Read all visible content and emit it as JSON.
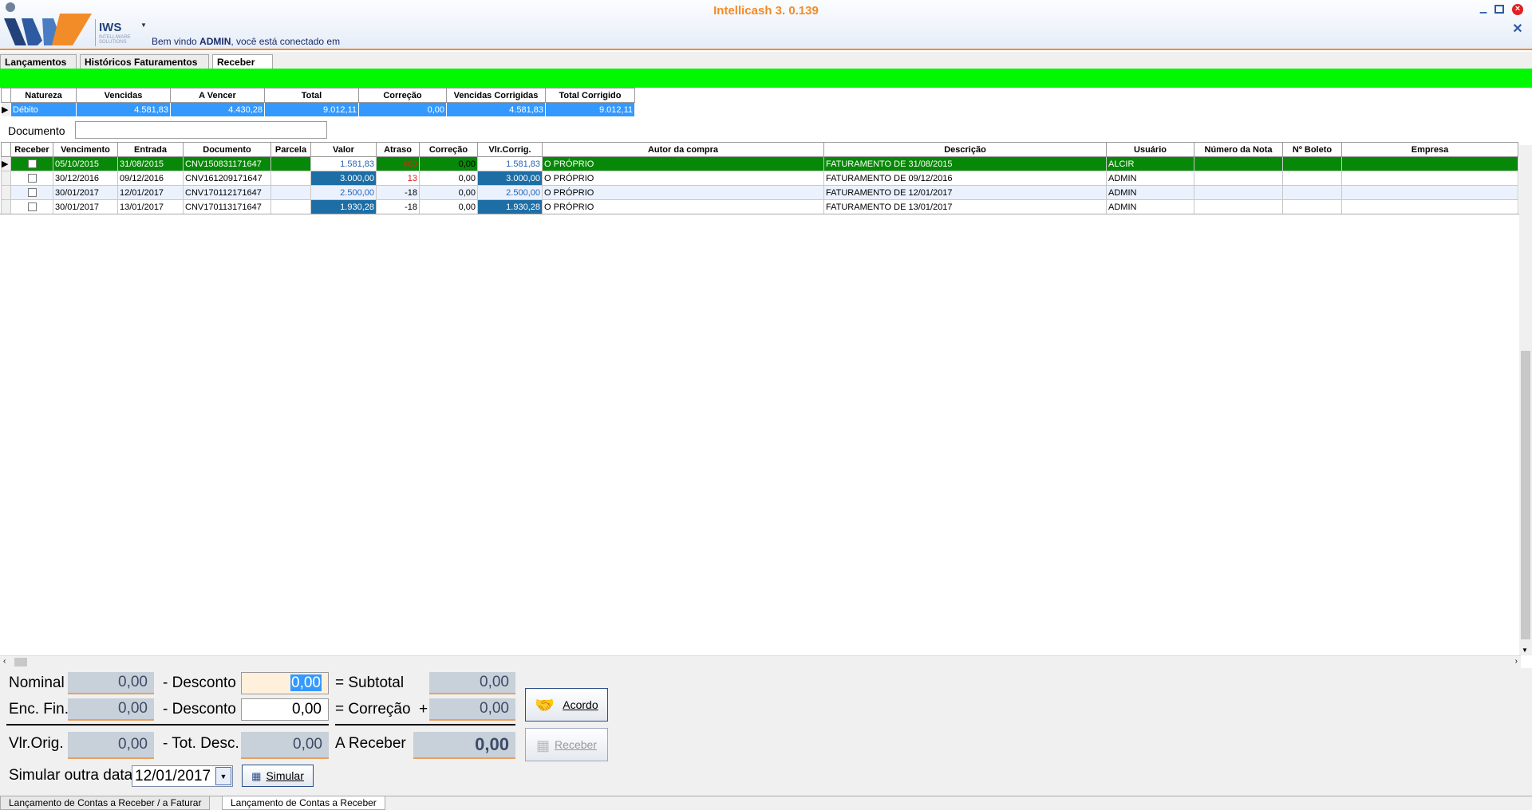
{
  "window": {
    "title": "Intellicash 3. 0.139"
  },
  "logo": {
    "name": "IWS",
    "tagline": "INTELLIWARE SOLUTIONS"
  },
  "welcome": {
    "prefix": "Bem vindo ",
    "user": "ADMIN",
    "suffix": ", você está conectado em"
  },
  "tabs": [
    "Lançamentos",
    "Históricos Faturamentos",
    "Receber"
  ],
  "summary": {
    "headers": [
      "Natureza",
      "Vencidas",
      "A Vencer",
      "Total",
      "Correção",
      "Vencidas Corrigidas",
      "Total Corrigido"
    ],
    "row": [
      "Débito",
      "4.581,83",
      "4.430,28",
      "9.012,11",
      "0,00",
      "4.581,83",
      "9.012,11"
    ]
  },
  "document": {
    "label": "Documento",
    "value": ""
  },
  "grid": {
    "headers": [
      "Receber",
      "Vencimento",
      "Entrada",
      "Documento",
      "Parcela",
      "Valor",
      "Atraso",
      "Correção",
      "Vlr.Corrig.",
      "Autor da compra",
      "Descrição",
      "Usuário",
      "Número da Nota",
      "Nº Boleto",
      "Empresa"
    ],
    "rows": [
      [
        "",
        "05/10/2015",
        "31/08/2015",
        "CNV150831171647",
        "",
        "1.581,83",
        "460",
        "0,00",
        "1.581,83",
        "O PRÓPRIO",
        "FATURAMENTO DE 31/08/2015",
        "ALCIR",
        "",
        "",
        ""
      ],
      [
        "",
        "30/12/2016",
        "09/12/2016",
        "CNV161209171647",
        "",
        "3.000,00",
        "13",
        "0,00",
        "3.000,00",
        "O PRÓPRIO",
        "FATURAMENTO DE 09/12/2016",
        "ADMIN",
        "",
        "",
        ""
      ],
      [
        "",
        "30/01/2017",
        "12/01/2017",
        "CNV170112171647",
        "",
        "2.500,00",
        "-18",
        "0,00",
        "2.500,00",
        "O PRÓPRIO",
        "FATURAMENTO DE 12/01/2017",
        "ADMIN",
        "",
        "",
        ""
      ],
      [
        "",
        "30/01/2017",
        "13/01/2017",
        "CNV170113171647",
        "",
        "1.930,28",
        "-18",
        "0,00",
        "1.930,28",
        "O PRÓPRIO",
        "FATURAMENTO DE 13/01/2017",
        "ADMIN",
        "",
        "",
        ""
      ]
    ]
  },
  "totals": {
    "nominal_label": "Nominal",
    "nominal": "0,00",
    "desconto_label": "- Desconto",
    "desconto1": "0,00",
    "desconto2": "0,00",
    "subtotal_label": "= Subtotal",
    "subtotal": "0,00",
    "encfin_label": "Enc. Fin.",
    "encfin": "0,00",
    "correcao_label": "= Correção",
    "plus": "+",
    "correcao": "0,00",
    "vlrorig_label": "Vlr.Orig.",
    "vlrorig": "0,00",
    "totdesc_label": "- Tot. Desc.",
    "totdesc": "0,00",
    "areceber_label": "A Receber",
    "areceber": "0,00"
  },
  "buttons": {
    "acordo": "Acordo",
    "receber": "Receber",
    "simular": "Simular"
  },
  "simulate": {
    "label": "Simular outra data",
    "date": "12/01/2017"
  },
  "footer_tabs": [
    "Lançamento de Contas a Receber / a Faturar",
    "Lançamento de Contas a Receber"
  ]
}
